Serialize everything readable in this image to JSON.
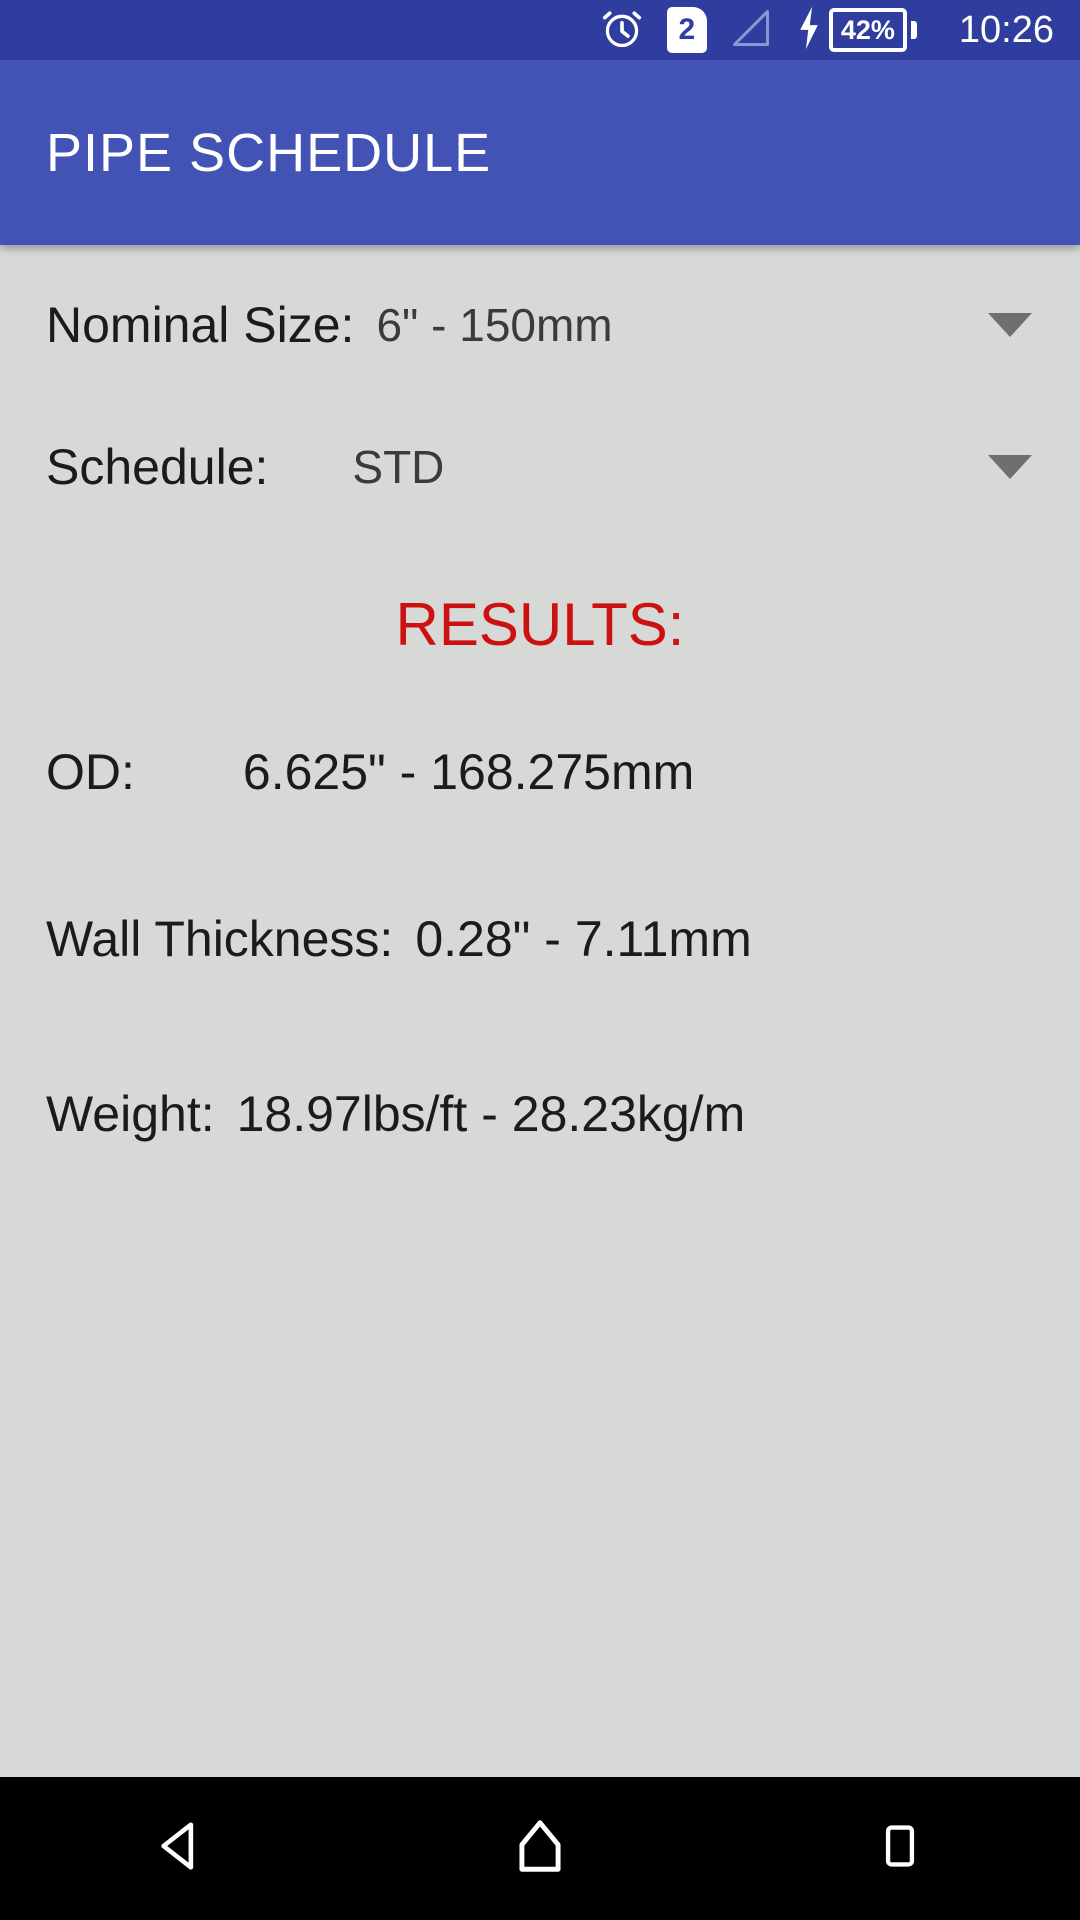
{
  "status_bar": {
    "background": "#2f3e9e",
    "alarm_icon": "alarm-clock-icon",
    "sim_icon": "sim-card-icon",
    "sim_label": "2",
    "signal_icon": "signal-bars-empty-icon",
    "charging_icon": "charging-bolt-icon",
    "battery_icon": "battery-icon",
    "battery_level": "42%",
    "time": "10:26"
  },
  "app_bar": {
    "title": "PIPE SCHEDULE",
    "background": "#4252b5"
  },
  "form": {
    "nominal_size": {
      "label": "Nominal Size:",
      "value": "6\" - 150mm",
      "caret_icon": "chevron-down-icon"
    },
    "schedule": {
      "label": "Schedule:",
      "value": "STD",
      "caret_icon": "chevron-down-icon"
    }
  },
  "results": {
    "title": "RESULTS:",
    "title_color": "#cc1111",
    "rows": [
      {
        "label": "OD:",
        "value": "6.625\" - 168.275mm"
      },
      {
        "label": "Wall Thickness:",
        "value": "0.28\" - 7.11mm"
      },
      {
        "label": "Weight:",
        "value": "18.97lbs/ft - 28.23kg/m"
      }
    ]
  },
  "nav_bar": {
    "background": "#000000",
    "back_icon": "back-triangle-icon",
    "home_icon": "home-icon",
    "recents_icon": "recents-square-icon"
  }
}
